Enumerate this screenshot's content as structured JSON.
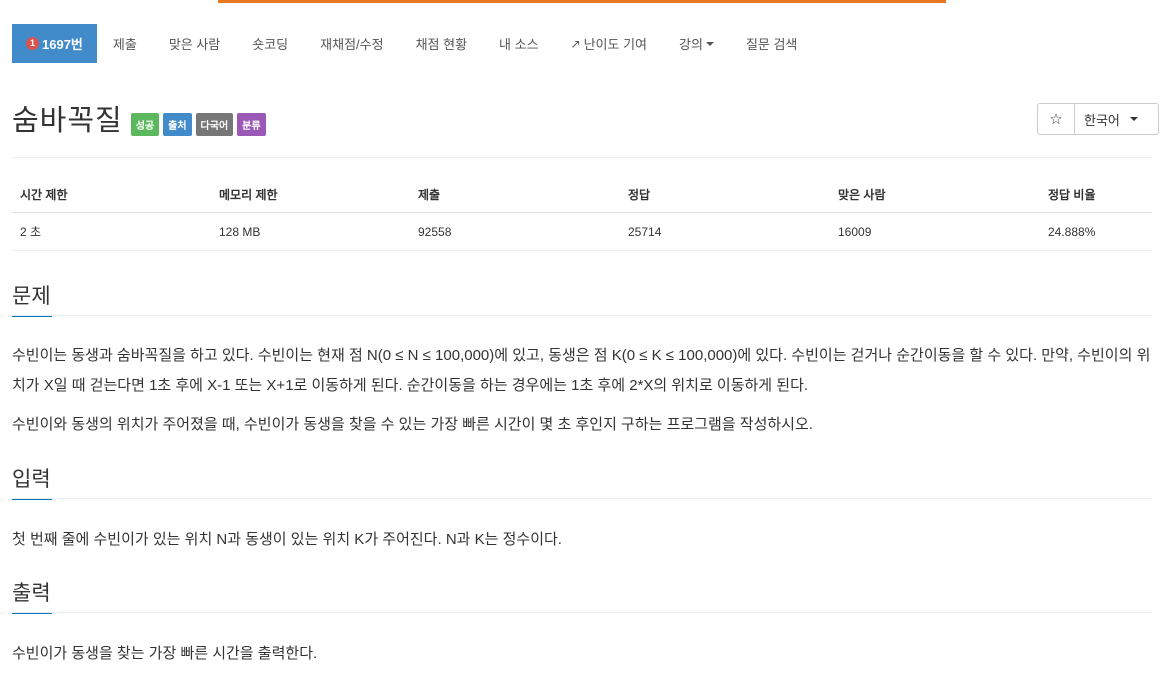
{
  "nav": {
    "active_tab": {
      "badge": "1",
      "label": "1697번"
    },
    "tabs": [
      "제출",
      "맞은 사람",
      "숏코딩",
      "재채점/수정",
      "채점 현황",
      "내 소스",
      "난이도 기여",
      "강의",
      "질문 검색"
    ]
  },
  "problem": {
    "title": "숨바꼭질",
    "labels": [
      {
        "text": "성공",
        "color": "#5cb85c"
      },
      {
        "text": "출처",
        "color": "#428bca"
      },
      {
        "text": "다국어",
        "color": "#777777"
      },
      {
        "text": "분류",
        "color": "#9b59b6"
      }
    ]
  },
  "lang": {
    "star": "☆",
    "selected": "한국어"
  },
  "stats": {
    "headers": [
      "시간 제한",
      "메모리 제한",
      "제출",
      "정답",
      "맞은 사람",
      "정답 비율"
    ],
    "values": [
      "2 초",
      "128 MB",
      "92558",
      "25714",
      "16009",
      "24.888%"
    ]
  },
  "sections": {
    "problem_heading": "문제",
    "problem_p1": "수빈이는 동생과 숨바꼭질을 하고 있다. 수빈이는 현재 점 N(0 ≤ N ≤ 100,000)에 있고, 동생은 점 K(0 ≤ K ≤ 100,000)에 있다. 수빈이는 걷거나 순간이동을 할 수 있다. 만약, 수빈이의 위치가 X일 때 걷는다면 1초 후에 X-1 또는 X+1로 이동하게 된다. 순간이동을 하는 경우에는 1초 후에 2*X의 위치로 이동하게 된다.",
    "problem_p2": "수빈이와 동생의 위치가 주어졌을 때, 수빈이가 동생을 찾을 수 있는 가장 빠른 시간이 몇 초 후인지 구하는 프로그램을 작성하시오.",
    "input_heading": "입력",
    "input_text": "첫 번째 줄에 수빈이가 있는 위치 N과 동생이 있는 위치 K가 주어진다. N과 K는 정수이다.",
    "output_heading": "출력",
    "output_text": "수빈이가 동생을 찾는 가장 빠른 시간을 출력한다."
  }
}
